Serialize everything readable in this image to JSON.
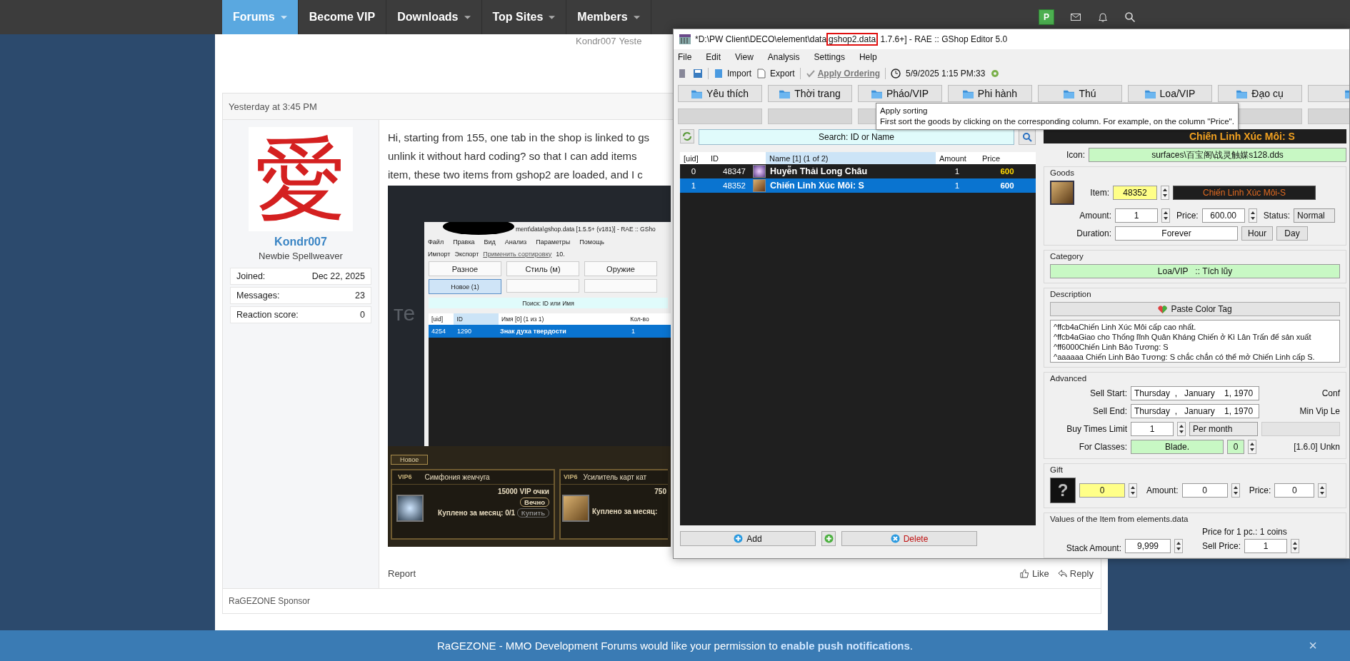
{
  "nav": {
    "items": [
      {
        "label": "Forums",
        "selected": true,
        "dropdown": true
      },
      {
        "label": "Become VIP",
        "selected": false,
        "dropdown": false
      },
      {
        "label": "Downloads",
        "selected": false,
        "dropdown": true
      },
      {
        "label": "Top Sites",
        "selected": false,
        "dropdown": true
      },
      {
        "label": "Members",
        "selected": false,
        "dropdown": true
      }
    ],
    "badge": "P"
  },
  "thread_meta": {
    "author": "Kondr007",
    "time": "Yeste"
  },
  "post": {
    "date": "Yesterday at 3:45 PM",
    "avatar_glyph": "愛",
    "user": {
      "name": "Kondr007",
      "title": "Newbie Spellweaver",
      "stats": [
        {
          "label": "Joined:",
          "value": "Dec 22, 2025"
        },
        {
          "label": "Messages:",
          "value": "23"
        },
        {
          "label": "Reaction score:",
          "value": "0"
        }
      ]
    },
    "lines": [
      "Hi, starting from 155, one tab in the shop is linked to gs",
      "unlink it without hard coding? so that I can add items",
      "item, these two items from gshop2 are loaded, and I c"
    ],
    "screenshot": {
      "title": "ment\\data\\gshop.data [1.5.5+ (v181)] - RAE :: GSho",
      "menu": [
        "Файл",
        "Правка",
        "Вид",
        "Анализ",
        "Параметры",
        "Помощь"
      ],
      "toolbar": {
        "import": "Импорт",
        "export": "Экспорт",
        "apply": "Применить сортировку",
        "time": "10."
      },
      "tabs": [
        "Разное",
        "Стиль (м)",
        "Оружие"
      ],
      "subtabs": [
        {
          "label": "Новое (1)",
          "selected": true
        },
        {
          "selected": false
        },
        {
          "selected": false
        }
      ],
      "search": "Поиск: ID или Имя",
      "columns": [
        {
          "label": "[uid]",
          "sorted": false
        },
        {
          "label": "ID",
          "sorted": true
        },
        {
          "label": "Имя [0] (1 из 1)",
          "sorted": false
        },
        {
          "label": "Кол-во",
          "sorted": false
        }
      ],
      "row": {
        "uid": "4254",
        "id": "1290",
        "name": "Знак духа твердости",
        "amount": "1",
        "selected": true
      },
      "background_text": "те",
      "game": {
        "tab": "Новое",
        "cards": [
          {
            "badge": "VIP6",
            "name": "Симфония жемчуга",
            "price": "15000 VIP очки",
            "duration": "Вечно",
            "bought": "Куплено за месяц: 0/1",
            "buy": "Купить"
          },
          {
            "badge": "VIP6",
            "name": "Усилитель карт кат",
            "price": "750",
            "bought": "Куплено за месяц:"
          }
        ]
      }
    },
    "actions": {
      "report": "Report",
      "like": "Like",
      "reply": "Reply"
    }
  },
  "sponsor": "RaGEZONE Sponsor",
  "notification": {
    "text": "RaGEZONE - MMO Development Forums would like your permission to ",
    "link": "enable push notifications",
    "end": ".",
    "close": "×"
  },
  "gshop": {
    "title": {
      "prefix": "*D:\\PW Client\\DECO\\element\\data",
      "highlight": "gshop2.data",
      "suffix": "1.7.6+] - RAE :: GShop Editor 5.0"
    },
    "menu": [
      "File",
      "Edit",
      "View",
      "Analysis",
      "Settings",
      "Help"
    ],
    "toolbar": {
      "import": "Import",
      "export": "Export",
      "apply": "Apply Ordering",
      "apply_disabled": true,
      "time": "5/9/2025 1:15 PM:33"
    },
    "tabs": [
      "Yêu thích",
      "Thời trang",
      "Pháo/VIP",
      "Phi hành",
      "Thú",
      "Loa/VIP",
      "Đạo cụ"
    ],
    "tooltip": {
      "title": "Apply sorting",
      "text": "First sort the goods by clicking on the corresponding column. For example, on the column \"Price\"."
    },
    "search": {
      "placeholder": "Search: ID or Name"
    },
    "columns": [
      {
        "label": "[uid]",
        "sorted": false
      },
      {
        "label": "ID",
        "sorted": false
      },
      {
        "label": "Name [1] (1 of 2)",
        "sorted": true
      },
      {
        "label": "Amount",
        "sorted": false
      },
      {
        "label": "Price",
        "sorted": false
      }
    ],
    "rows": [
      {
        "uid": "0",
        "id": "48347",
        "name": "Huyễn Thải Long Châu",
        "amount": "1",
        "price": "600",
        "selected": false
      },
      {
        "uid": "1",
        "id": "48352",
        "name": "Chiến Linh Xúc Môi: S",
        "amount": "1",
        "price": "600",
        "selected": true
      }
    ],
    "buttons": {
      "add": "Add",
      "delete": "Delete"
    },
    "detail": {
      "title": "Chiến Linh Xúc Môi: S",
      "icon_label": "Icon:",
      "icon_path": "surfaces\\百宝阁\\战灵触媒s128.dds",
      "goods": {
        "legend": "Goods",
        "item_label": "Item:",
        "item": "48352",
        "item_name": "Chiến Linh Xúc Môi-S",
        "amount_label": "Amount:",
        "amount": "1",
        "price_label": "Price:",
        "price": "600.00",
        "status_label": "Status:",
        "status": "Normal",
        "duration_label": "Duration:",
        "duration": "Forever",
        "duration_buttons": [
          "Hour",
          "Day"
        ]
      },
      "category": {
        "legend": "Category",
        "value": "Loa/VIP   :: Tích lũy"
      },
      "description": {
        "legend": "Description",
        "paste": "Paste Color Tag",
        "lines": [
          "^ffcb4aChiến Linh Xúc Môi cấp cao nhất.",
          "^ffcb4aGiao cho Thống lĩnh Quân Kháng Chiến ở Kì Lân Trấn để sản xuất",
          "^ff6000Chiến Linh Bảo Tương: S",
          "^aaaaaa Chiến Linh Bảo Tương: S chắc chắn có thể mở Chiến Linh cấp S."
        ]
      },
      "advanced": {
        "legend": "Advanced",
        "sell_start_label": "Sell Start:",
        "sell_start": "Thursday  ,   January    1, 1970",
        "side_1": "Conf",
        "sell_end_label": "Sell End:",
        "sell_end": "Thursday  ,   January    1, 1970",
        "side_2": "Min Vip Le",
        "buy_label": "Buy Times Limit",
        "buy": "1",
        "period": "Per month",
        "classes_label": "For Classes:",
        "classes": "Blade.",
        "classes_num": "0",
        "side_3": "[1.6.0] Unkn"
      },
      "gift": {
        "legend": "Gift",
        "icon": "?",
        "id": "0",
        "amount_label": "Amount:",
        "amount": "0",
        "price_label": "Price:",
        "price": "0"
      },
      "values": {
        "legend": "Values of the Item from elements.data",
        "stack_label": "Stack Amount:",
        "stack": "9,999",
        "note": "Price for 1 pc.: 1 coins",
        "sell_label": "Sell Price:",
        "sell": "1"
      }
    }
  }
}
